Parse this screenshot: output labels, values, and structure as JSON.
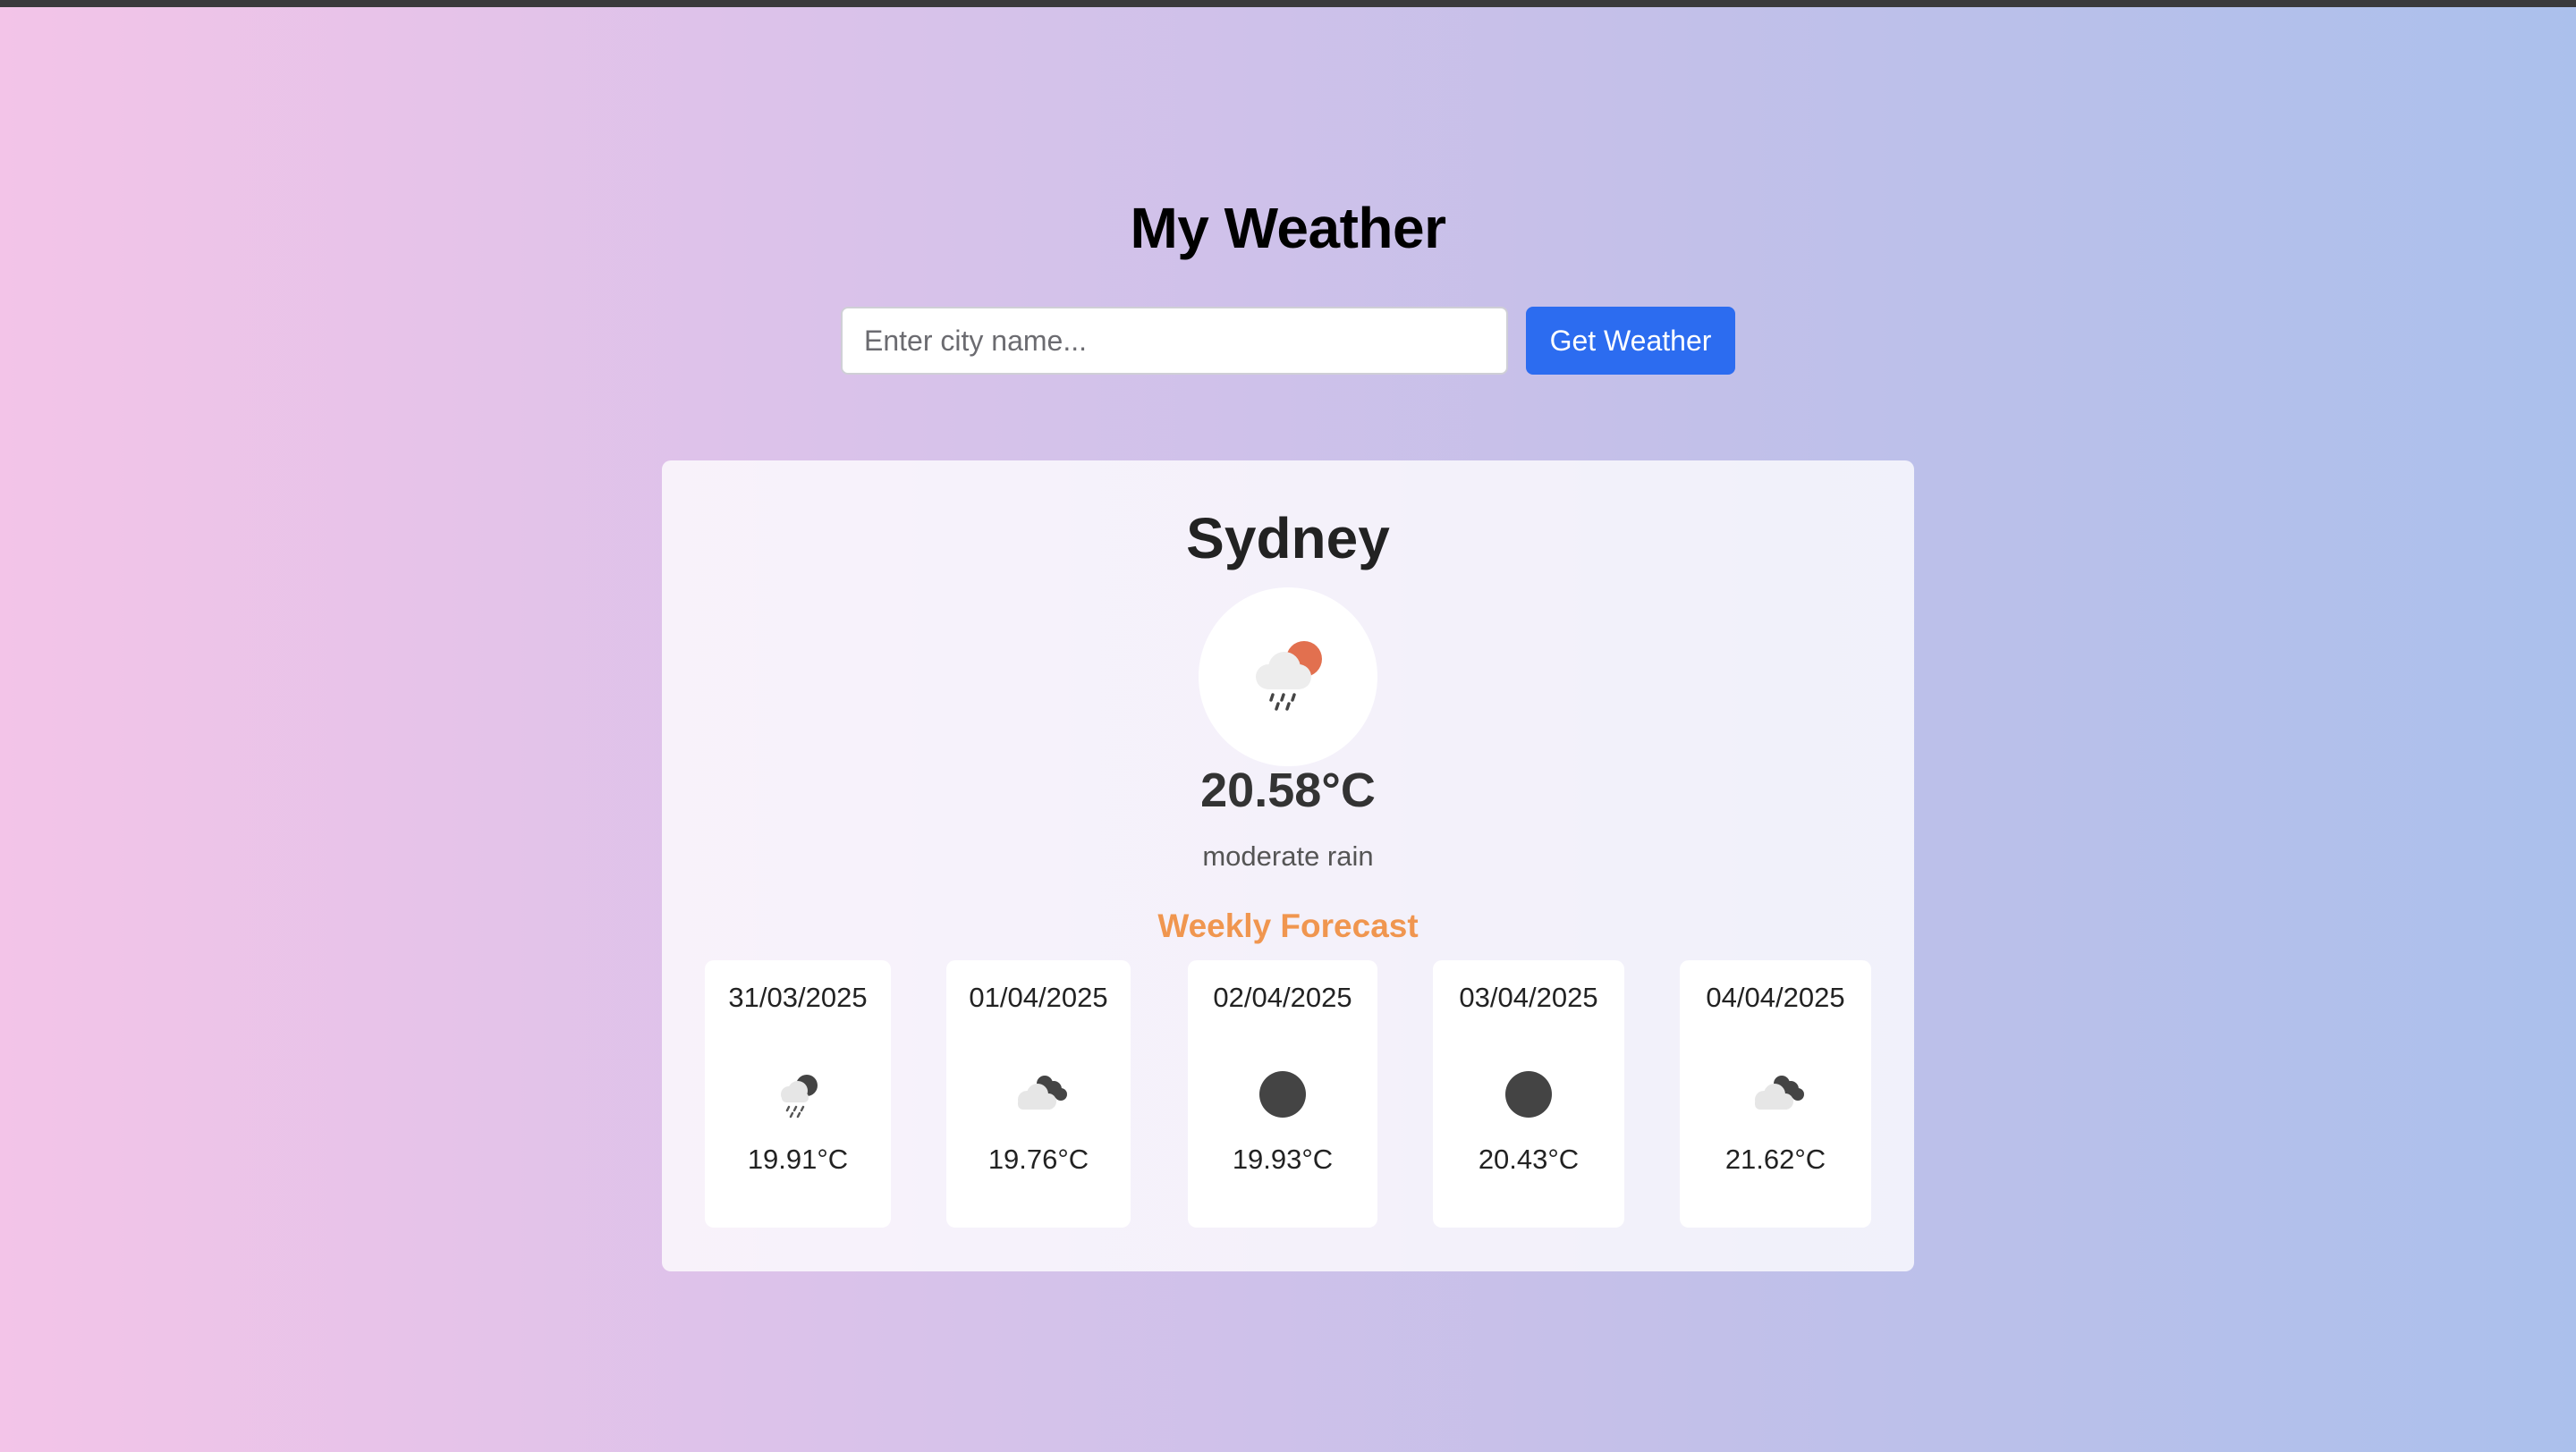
{
  "header": {
    "title": "My Weather"
  },
  "search": {
    "placeholder": "Enter city name...",
    "value": "",
    "button_label": "Get Weather"
  },
  "current": {
    "city": "Sydney",
    "icon": "moderate-rain-icon",
    "temperature": "20.58°C",
    "description": "moderate rain"
  },
  "forecast": {
    "title": "Weekly Forecast",
    "days": [
      {
        "date": "31/03/2025",
        "icon": "rain-night-icon",
        "temp": "19.91°C"
      },
      {
        "date": "01/04/2025",
        "icon": "broken-clouds-night-icon",
        "temp": "19.76°C"
      },
      {
        "date": "02/04/2025",
        "icon": "clear-night-icon",
        "temp": "19.93°C"
      },
      {
        "date": "03/04/2025",
        "icon": "clear-night-icon",
        "temp": "20.43°C"
      },
      {
        "date": "04/04/2025",
        "icon": "broken-clouds-night-icon",
        "temp": "21.62°C"
      }
    ]
  },
  "colors": {
    "accent": "#2c6cf0",
    "forecast_title": "#f0964f",
    "sun": "#e2704f"
  }
}
